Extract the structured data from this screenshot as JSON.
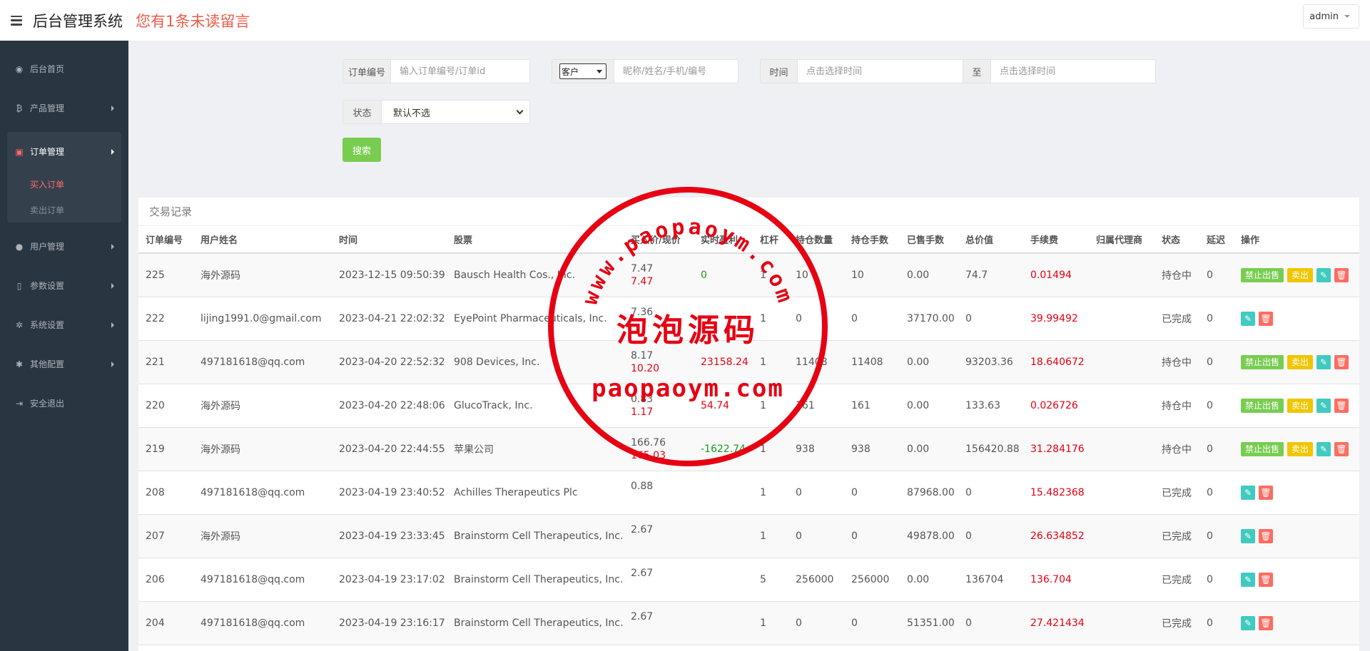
{
  "header": {
    "app_title": "后台管理系统",
    "unread_notice": "您有1条未读留言",
    "user": "admin"
  },
  "sidebar": {
    "items": [
      {
        "label": "后台首页",
        "icon": "dashboard-icon",
        "glyph": "◉"
      },
      {
        "label": "产品管理",
        "icon": "bitcoin-icon",
        "glyph": "₿"
      },
      {
        "label": "订单管理",
        "icon": "copy-icon",
        "glyph": "▣"
      },
      {
        "label": "用户管理",
        "icon": "user-icon",
        "glyph": "●"
      },
      {
        "label": "参数设置",
        "icon": "file-icon",
        "glyph": "▯"
      },
      {
        "label": "系统设置",
        "icon": "cogs-icon",
        "glyph": "✲"
      },
      {
        "label": "其他配置",
        "icon": "gear-icon",
        "glyph": "✱"
      },
      {
        "label": "安全退出",
        "icon": "sign-out-icon",
        "glyph": "⇥"
      }
    ],
    "order_sub": [
      "买入订单",
      "卖出订单"
    ]
  },
  "filters": {
    "order_no_label": "订单编号",
    "order_no_placeholder": "输入订单编号/订单id",
    "customer_select": "客户",
    "customer_placeholder": "昵称/姓名/手机/编号",
    "time_label": "时间",
    "time_start_placeholder": "点击选择时间",
    "time_to": "至",
    "time_end_placeholder": "点击选择时间",
    "status_label": "状态",
    "status_value": "默认不选",
    "search_label": "搜索"
  },
  "table": {
    "title": "交易记录",
    "columns": [
      "订单编号",
      "用户姓名",
      "时间",
      "股票",
      "买入价/现价",
      "实时盈利",
      "杠杆",
      "持仓数量",
      "持仓手数",
      "已售手数",
      "总价值",
      "手续费",
      "归属代理商",
      "状态",
      "延迟",
      "操作"
    ],
    "rows": [
      {
        "id": "225",
        "user": "海外源码",
        "time": "2023-12-15 09:50:39",
        "stock": "Bausch Health Cos., Inc.",
        "buy": "7.47",
        "cur": "7.47",
        "profit": "0",
        "profit_sign": "neg",
        "lev": "1",
        "qty": "10",
        "hands": "10",
        "sold": "0.00",
        "total": "74.7",
        "fee": "0.01494",
        "agent": "",
        "status": "持仓中",
        "delay": "0",
        "holding": true
      },
      {
        "id": "222",
        "user": "lijing1991.0@gmail.com",
        "time": "2023-04-21 22:02:32",
        "stock": "EyePoint Pharmaceuticals, Inc.",
        "buy": "7.36",
        "cur": "",
        "profit": "",
        "profit_sign": "",
        "lev": "1",
        "qty": "0",
        "hands": "0",
        "sold": "37170.00",
        "total": "0",
        "fee": "39.99492",
        "agent": "",
        "status": "已完成",
        "delay": "0",
        "holding": false
      },
      {
        "id": "221",
        "user": "497181618@qq.com",
        "time": "2023-04-20 22:52:32",
        "stock": "908 Devices, Inc.",
        "buy": "8.17",
        "cur": "10.20",
        "profit": "23158.24",
        "profit_sign": "pos",
        "lev": "1",
        "qty": "11408",
        "hands": "11408",
        "sold": "0.00",
        "total": "93203.36",
        "fee": "18.640672",
        "agent": "",
        "status": "持仓中",
        "delay": "0",
        "holding": true
      },
      {
        "id": "220",
        "user": "海外源码",
        "time": "2023-04-20 22:48:06",
        "stock": "GlucoTrack, Inc.",
        "buy": "0.83",
        "cur": "1.17",
        "profit": "54.74",
        "profit_sign": "pos",
        "lev": "1",
        "qty": "161",
        "hands": "161",
        "sold": "0.00",
        "total": "133.63",
        "fee": "0.026726",
        "agent": "",
        "status": "持仓中",
        "delay": "0",
        "holding": true
      },
      {
        "id": "219",
        "user": "海外源码",
        "time": "2023-04-20 22:44:55",
        "stock": "苹果公司",
        "buy": "166.76",
        "cur": "165.03",
        "profit": "-1622.74",
        "profit_sign": "neg",
        "lev": "1",
        "qty": "938",
        "hands": "938",
        "sold": "0.00",
        "total": "156420.88",
        "fee": "31.284176",
        "agent": "",
        "status": "持仓中",
        "delay": "0",
        "holding": true
      },
      {
        "id": "208",
        "user": "497181618@qq.com",
        "time": "2023-04-19 23:40:52",
        "stock": "Achilles Therapeutics Plc",
        "buy": "0.88",
        "cur": "",
        "profit": "",
        "profit_sign": "",
        "lev": "1",
        "qty": "0",
        "hands": "0",
        "sold": "87968.00",
        "total": "0",
        "fee": "15.482368",
        "agent": "",
        "status": "已完成",
        "delay": "0",
        "holding": false
      },
      {
        "id": "207",
        "user": "海外源码",
        "time": "2023-04-19 23:33:45",
        "stock": "Brainstorm Cell Therapeutics, Inc.",
        "buy": "2.67",
        "cur": "",
        "profit": "",
        "profit_sign": "",
        "lev": "1",
        "qty": "0",
        "hands": "0",
        "sold": "49878.00",
        "total": "0",
        "fee": "26.634852",
        "agent": "",
        "status": "已完成",
        "delay": "0",
        "holding": false
      },
      {
        "id": "206",
        "user": "497181618@qq.com",
        "time": "2023-04-19 23:17:02",
        "stock": "Brainstorm Cell Therapeutics, Inc.",
        "buy": "2.67",
        "cur": "",
        "profit": "",
        "profit_sign": "",
        "lev": "5",
        "qty": "256000",
        "hands": "256000",
        "sold": "0.00",
        "total": "136704",
        "fee": "136.704",
        "agent": "",
        "status": "已完成",
        "delay": "0",
        "holding": false
      },
      {
        "id": "204",
        "user": "497181618@qq.com",
        "time": "2023-04-19 23:16:17",
        "stock": "Brainstorm Cell Therapeutics, Inc.",
        "buy": "2.67",
        "cur": "",
        "profit": "",
        "profit_sign": "",
        "lev": "1",
        "qty": "0",
        "hands": "0",
        "sold": "51351.00",
        "total": "0",
        "fee": "27.421434",
        "agent": "",
        "status": "已完成",
        "delay": "0",
        "holding": false
      }
    ],
    "actions": {
      "stop_sell": "禁止出售",
      "sell": "卖出"
    }
  },
  "watermark": {
    "ring_text": "www.paopaoym.com",
    "center_cn": "泡泡源码",
    "center_en": "paopaoym.com",
    "color": "#e60012"
  },
  "colors": {
    "sidebar_bg": "#2a3542",
    "accent_red": "#ff6c60",
    "search_green": "#78cd51",
    "sell_yellow": "#f1c500",
    "edit_teal": "#41cac0"
  }
}
